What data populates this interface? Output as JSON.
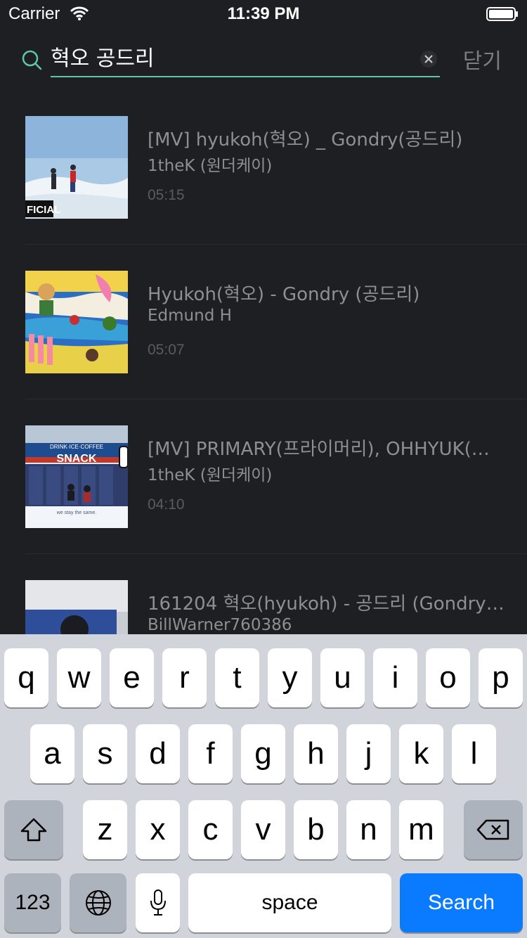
{
  "status_bar": {
    "carrier": "Carrier",
    "time": "11:39 PM"
  },
  "search": {
    "query": "혁오 공드리",
    "close_label": "닫기",
    "accent_color": "#5ec6a6"
  },
  "results": [
    {
      "title": "[MV] hyukoh(혁오) _ Gondry(공드리)",
      "channel": "1theK (원더케이)",
      "duration": "05:15",
      "thumb_caption": "FICIAL"
    },
    {
      "title": "Hyukoh(혁오) - Gondry (공드리)",
      "channel": "Edmund H",
      "duration": "05:07"
    },
    {
      "title": "[MV] PRIMARY(프라이머리), OHHYUK(오…",
      "channel": "1theK (원더케이)",
      "duration": "04:10",
      "thumb_sign": "SNACK",
      "thumb_banner": "DRINK·ICE·COFFEE",
      "thumb_caption": "we stay the same."
    },
    {
      "title": "161204 혁오(hyukoh) - 공드리 (Gondry)…",
      "channel": "BillWarner760386",
      "duration": ""
    }
  ],
  "keyboard": {
    "row1": [
      "q",
      "w",
      "e",
      "r",
      "t",
      "y",
      "u",
      "i",
      "o",
      "p"
    ],
    "row2": [
      "a",
      "s",
      "d",
      "f",
      "g",
      "h",
      "j",
      "k",
      "l"
    ],
    "row3": [
      "z",
      "x",
      "c",
      "v",
      "b",
      "n",
      "m"
    ],
    "numbers_label": "123",
    "space_label": "space",
    "search_label": "Search",
    "search_color": "#0a7aff"
  }
}
